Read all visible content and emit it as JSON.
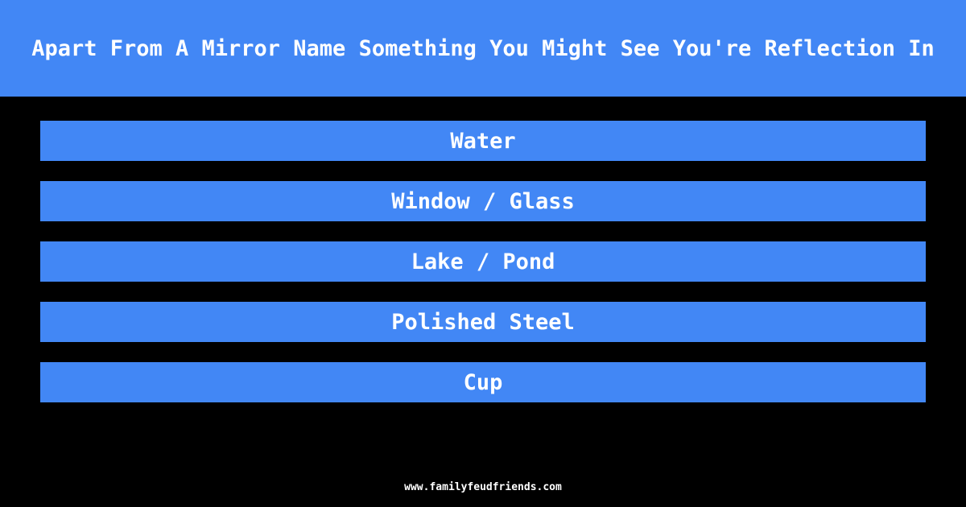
{
  "question": "Apart From A Mirror Name Something You Might See You're Reflection In",
  "answers": [
    {
      "label": "Water"
    },
    {
      "label": "Window / Glass"
    },
    {
      "label": "Lake / Pond"
    },
    {
      "label": "Polished Steel"
    },
    {
      "label": "Cup"
    }
  ],
  "footer": "www.familyfeudfriends.com",
  "colors": {
    "accent": "#4287f5",
    "background": "#000000",
    "text": "#ffffff"
  }
}
